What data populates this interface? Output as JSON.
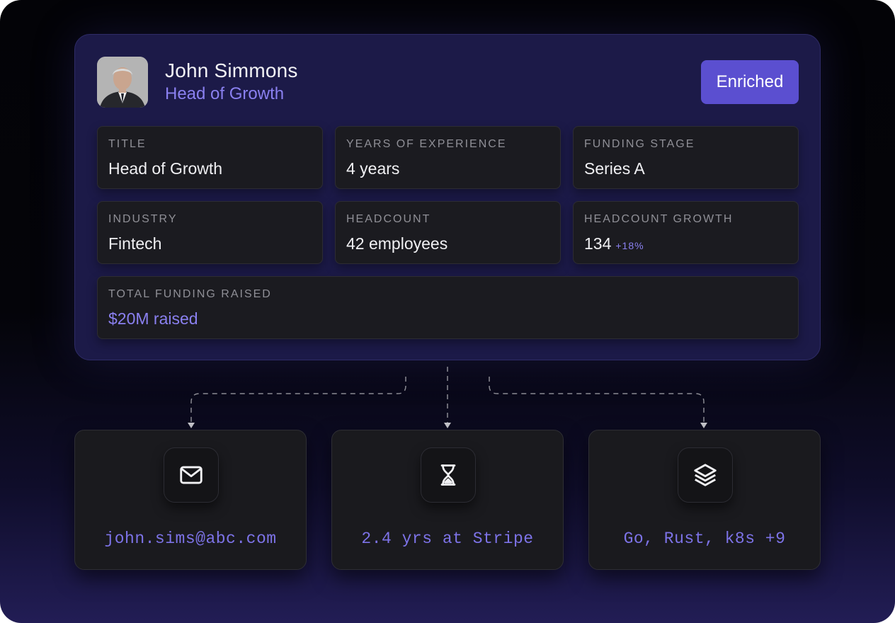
{
  "profile": {
    "name": "John Simmons",
    "role": "Head of Growth",
    "status_badge": "Enriched",
    "fields": {
      "title": {
        "label": "TITLE",
        "value": "Head of Growth"
      },
      "experience": {
        "label": "YEARS OF EXPERIENCE",
        "value": "4 years"
      },
      "funding_stage": {
        "label": "FUNDING STAGE",
        "value": "Series A"
      },
      "industry": {
        "label": "INDUSTRY",
        "value": "Fintech"
      },
      "headcount": {
        "label": "HEADCOUNT",
        "value": "42 employees"
      },
      "headcount_growth": {
        "label": "HEADCOUNT GROWTH",
        "value": "134",
        "delta": "+18%"
      },
      "total_funding": {
        "label": "TOTAL FUNDING RAISED",
        "value": "$20M raised"
      }
    }
  },
  "enrichments": [
    {
      "icon": "mail-icon",
      "text": "john.sims@abc.com"
    },
    {
      "icon": "hourglass-icon",
      "text": "2.4 yrs at Stripe"
    },
    {
      "icon": "layers-icon",
      "text": "Go, Rust, k8s +9"
    }
  ],
  "colors": {
    "accent": "#8a80f0",
    "badge": "#5b4fd0",
    "card_bg": "#1c1a48",
    "field_bg": "#1b1b20"
  }
}
